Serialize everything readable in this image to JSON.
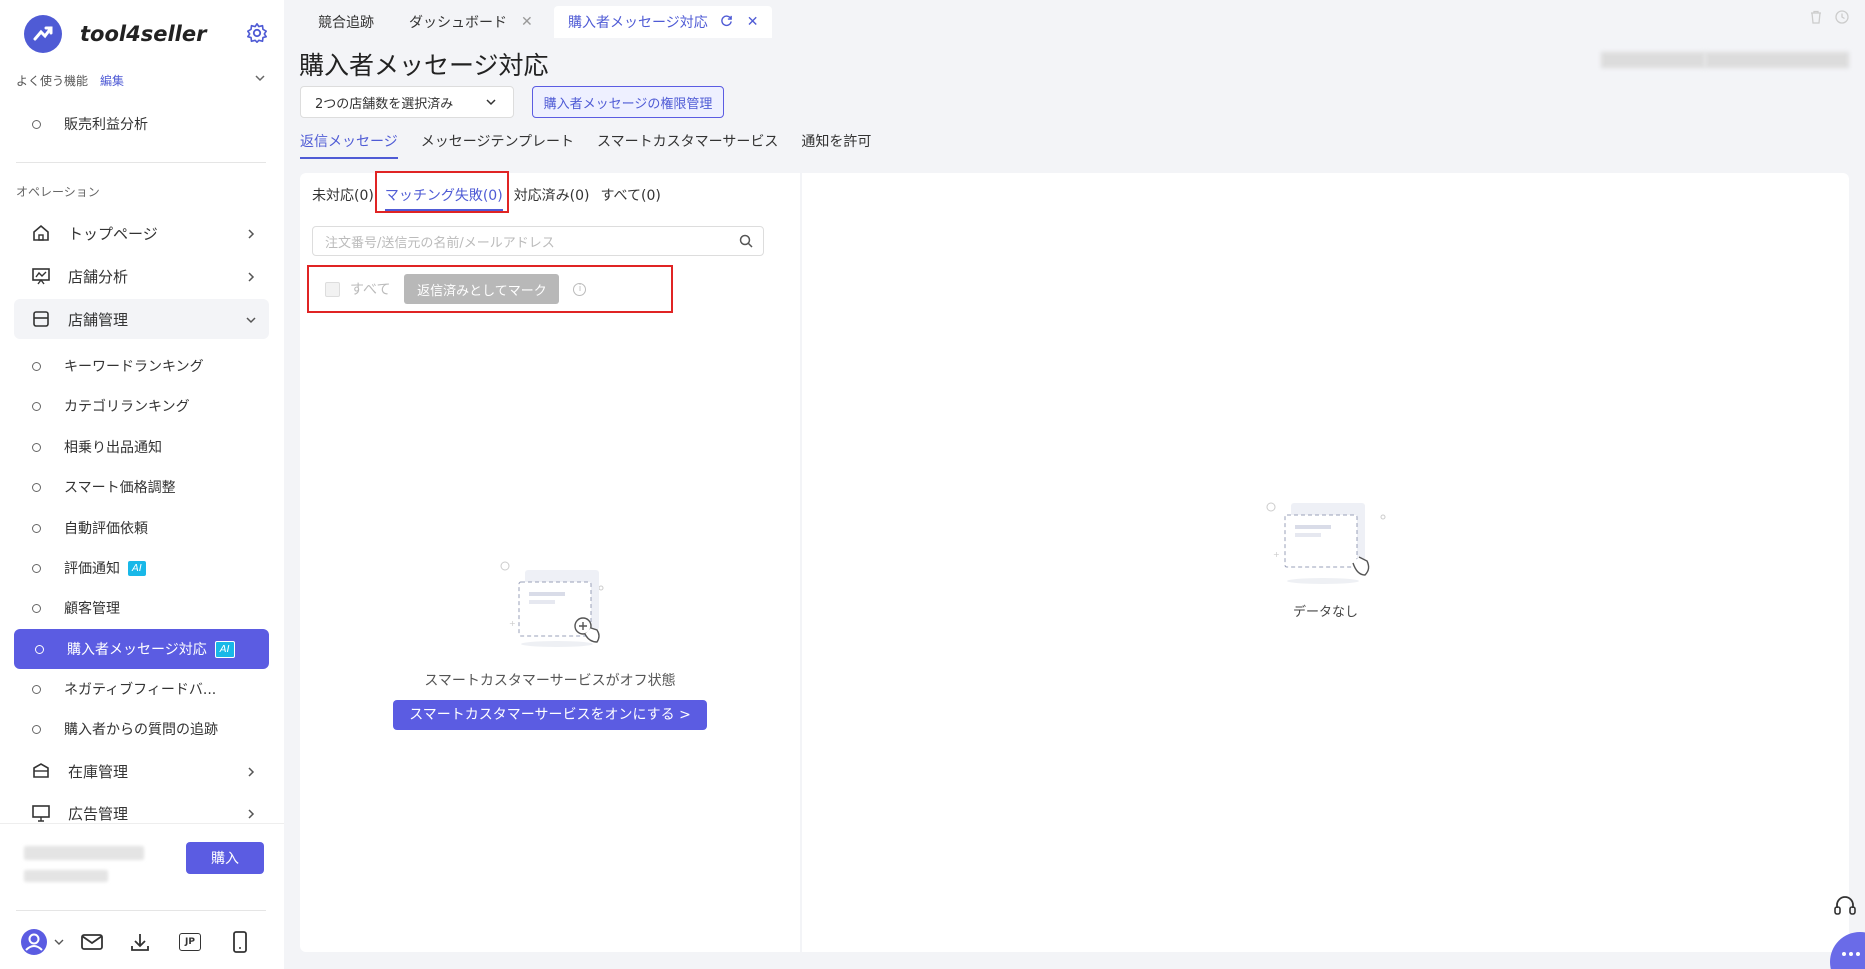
{
  "app": {
    "logo_text": "tool4seller"
  },
  "favorites": {
    "label": "よく使う機能",
    "edit": "編集",
    "items": [
      {
        "label": "販売利益分析"
      }
    ]
  },
  "sidebar": {
    "section_label": "オペレーション",
    "menu": {
      "home": "トップページ",
      "store_analysis": "店舗分析",
      "store_mgmt": "店舗管理",
      "inventory": "在庫管理",
      "ads": "広告管理"
    },
    "submenu": [
      "キーワードランキング",
      "カテゴリランキング",
      "相乗り出品通知",
      "スマート価格調整",
      "自動評価依頼",
      "評価通知",
      "顧客管理",
      "購入者メッセージ対応",
      "ネガティブフィードバ...",
      "購入者からの質問の追跡"
    ],
    "ai_badge": "AI",
    "buy_button": "購入",
    "lang_badge": "JP"
  },
  "tabs": [
    {
      "label": "競合追跡"
    },
    {
      "label": "ダッシュボード"
    },
    {
      "label": "購入者メッセージ対応"
    }
  ],
  "page": {
    "title": "購入者メッセージ対応",
    "store_select": "2つの店舗数を選択済み",
    "perm_button": "購入者メッセージの権限管理",
    "subtabs": [
      "返信メッセージ",
      "メッセージテンプレート",
      "スマートカスタマーサービス",
      "通知を許可"
    ]
  },
  "left_panel": {
    "filters": [
      "未対応(0)",
      "マッチング失敗(0)",
      "対応済み(0)",
      "すべて(0)"
    ],
    "search_placeholder": "注文番号/送信元の名前/メールアドレス",
    "select_all": "すべて",
    "mark_button": "返信済みとしてマーク",
    "empty_text": "スマートカスタマーサービスがオフ状態",
    "enable_button": "スマートカスタマーサービスをオンにする >"
  },
  "right_panel": {
    "empty_text": "データなし"
  },
  "colors": {
    "accent": "#5b5ce2",
    "highlight": "#e02424"
  }
}
